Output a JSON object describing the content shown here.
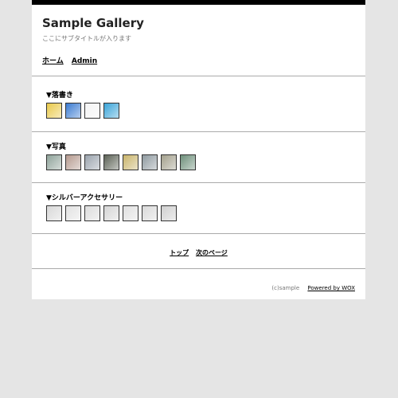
{
  "header": {
    "title": "Sample Gallery",
    "subtitle": "ここにサブタイトルが入ります",
    "nav": [
      "ホーム",
      "Admin"
    ]
  },
  "sections": [
    {
      "title": "▼落書き",
      "thumb_colors": [
        "#e9c94a",
        "#3b7bd1",
        "#f4f4f4",
        "#3aa4d8"
      ]
    },
    {
      "title": "▼写真",
      "thumb_colors": [
        "#8fa39a",
        "#b59a8f",
        "#9aa3ad",
        "#5b6155",
        "#c9b46a",
        "#8f9aa0",
        "#a3a08c",
        "#6d8f7a"
      ]
    },
    {
      "title": "▼シルバーアクセサリー",
      "thumb_colors": [
        "#d8d8d8",
        "#e2e2e2",
        "#dcdcdc",
        "#d5d5d5",
        "#e0e0e0",
        "#d9d9d9",
        "#cfcfcf"
      ]
    }
  ],
  "pager": {
    "top": "トップ",
    "next": "次のページ"
  },
  "footer": {
    "copyright": "(c)sample",
    "powered": "Powered by WOX"
  }
}
